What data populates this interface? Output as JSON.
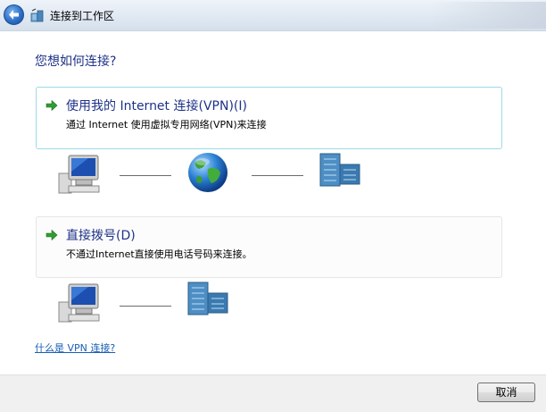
{
  "window": {
    "title": "连接到工作区"
  },
  "page": {
    "heading": "您想如何连接?"
  },
  "options": [
    {
      "title": "使用我的 Internet 连接(VPN)(I)",
      "description": "通过 Internet 使用虚拟专用网络(VPN)来连接",
      "selected": true
    },
    {
      "title": "直接拨号(D)",
      "description": "不通过Internet直接使用电话号码来连接。",
      "selected": false
    }
  ],
  "help_link": "什么是 VPN 连接?",
  "footer": {
    "cancel_label": "取消"
  },
  "icons": {
    "back": "back-arrow-icon",
    "app": "workplace-network-icon",
    "option_arrow": "green-arrow-icon",
    "computer": "computer-icon",
    "internet": "globe-icon",
    "workplace": "office-building-icon"
  },
  "colors": {
    "heading": "#1e3287",
    "link": "#1a5fb4",
    "selected_border": "#9cdbe8"
  }
}
